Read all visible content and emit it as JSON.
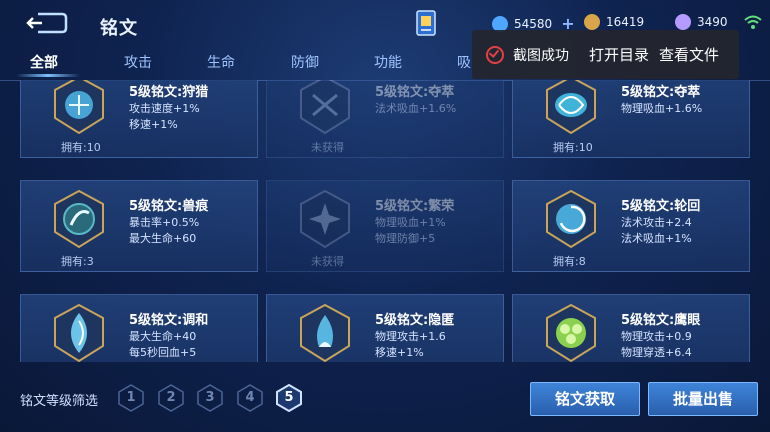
{
  "header": {
    "title": "铭文",
    "currencies": [
      {
        "name": "diamond",
        "value": "54580",
        "color": "#4fa6ff",
        "has_plus": true
      },
      {
        "name": "gold-coin",
        "value": "16419",
        "color": "#d9a54a",
        "has_plus": false
      },
      {
        "name": "crystal",
        "value": "3490",
        "color": "#b59bff",
        "has_plus": false
      }
    ]
  },
  "tabs": [
    {
      "label": "全部",
      "active": true
    },
    {
      "label": "攻击",
      "active": false
    },
    {
      "label": "生命",
      "active": false
    },
    {
      "label": "防御",
      "active": false
    },
    {
      "label": "功能",
      "active": false
    },
    {
      "label": "吸",
      "active": false
    }
  ],
  "toast": {
    "status_text": "截图成功",
    "open_dir_label": "打开目录",
    "view_file_label": "查看文件"
  },
  "cards": [
    {
      "name": "5级铭文:狩猎",
      "stats": [
        "攻击速度+1%",
        "移速+1%"
      ],
      "owned": "拥有:10",
      "obtained": true,
      "color": "#4fb6e8"
    },
    {
      "name": "5级铭文:夺萃",
      "stats": [
        "法术吸血+1.6%"
      ],
      "owned": "未获得",
      "obtained": false,
      "color": "#7c8fb8"
    },
    {
      "name": "5级铭文:夺萃",
      "stats": [
        "物理吸血+1.6%"
      ],
      "owned": "拥有:10",
      "obtained": true,
      "color": "#3fb3d9"
    },
    {
      "name": "5级铭文:兽痕",
      "stats": [
        "暴击率+0.5%",
        "最大生命+60"
      ],
      "owned": "拥有:3",
      "obtained": true,
      "color": "#58b9c8"
    },
    {
      "name": "5级铭文:繁荣",
      "stats": [
        "物理吸血+1%",
        "物理防御+5"
      ],
      "owned": "未获得",
      "obtained": false,
      "color": "#7c8fb8"
    },
    {
      "name": "5级铭文:轮回",
      "stats": [
        "法术攻击+2.4",
        "法术吸血+1%"
      ],
      "owned": "拥有:8",
      "obtained": true,
      "color": "#48a9d8"
    },
    {
      "name": "5级铭文:调和",
      "stats": [
        "最大生命+40",
        "每5秒回血+5"
      ],
      "owned": "",
      "obtained": true,
      "color": "#6cc3e8"
    },
    {
      "name": "5级铭文:隐匿",
      "stats": [
        "物理攻击+1.6",
        "移速+1%"
      ],
      "owned": "",
      "obtained": true,
      "color": "#57b6e0"
    },
    {
      "name": "5级铭文:鹰眼",
      "stats": [
        "物理攻击+0.9",
        "物理穿透+6.4"
      ],
      "owned": "",
      "obtained": true,
      "color": "#8bd14f"
    }
  ],
  "filter": {
    "label": "铭文等级筛选",
    "levels": [
      "1",
      "2",
      "3",
      "4",
      "5"
    ],
    "active_level": "5"
  },
  "actions": {
    "acquire_label": "铭文获取",
    "bulk_sell_label": "批量出售"
  }
}
